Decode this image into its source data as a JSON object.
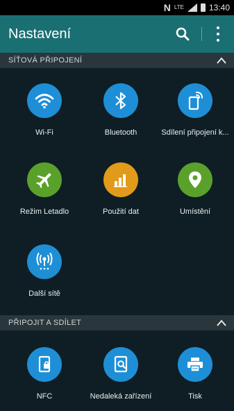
{
  "status": {
    "nfc": "N",
    "lte": "LTE",
    "time": "13:40"
  },
  "appbar": {
    "title": "Nastavení",
    "search_icon": "search-icon",
    "more_icon": "more-vert-icon"
  },
  "sections": {
    "network": {
      "title": "SÍŤOVÁ PŘIPOJENÍ"
    },
    "share": {
      "title": "PŘIPOJIT A SDÍLET"
    }
  },
  "tiles": {
    "wifi": {
      "label": "Wi-Fi",
      "icon": "wifi-icon",
      "color": "#1e8fd6"
    },
    "bluetooth": {
      "label": "Bluetooth",
      "icon": "bluetooth-icon",
      "color": "#1e8fd6"
    },
    "tethering": {
      "label": "Sdílení připojení k...",
      "icon": "tethering-icon",
      "color": "#1e8fd6"
    },
    "airplane": {
      "label": "Režim Letadlo",
      "icon": "airplane-icon",
      "color": "#5aa12c"
    },
    "data_usage": {
      "label": "Použití dat",
      "icon": "data-usage-icon",
      "color": "#e29a1a"
    },
    "location": {
      "label": "Umístění",
      "icon": "location-icon",
      "color": "#5aa12c"
    },
    "more_networks": {
      "label": "Další sítě",
      "icon": "antenna-icon",
      "color": "#1e8fd6"
    },
    "nfc": {
      "label": "NFC",
      "icon": "nfc-icon",
      "color": "#1e8fd6"
    },
    "nearby": {
      "label": "Nedaleká zařízení",
      "icon": "nearby-devices-icon",
      "color": "#1e8fd6"
    },
    "print": {
      "label": "Tisk",
      "icon": "printer-icon",
      "color": "#1e8fd6"
    }
  }
}
